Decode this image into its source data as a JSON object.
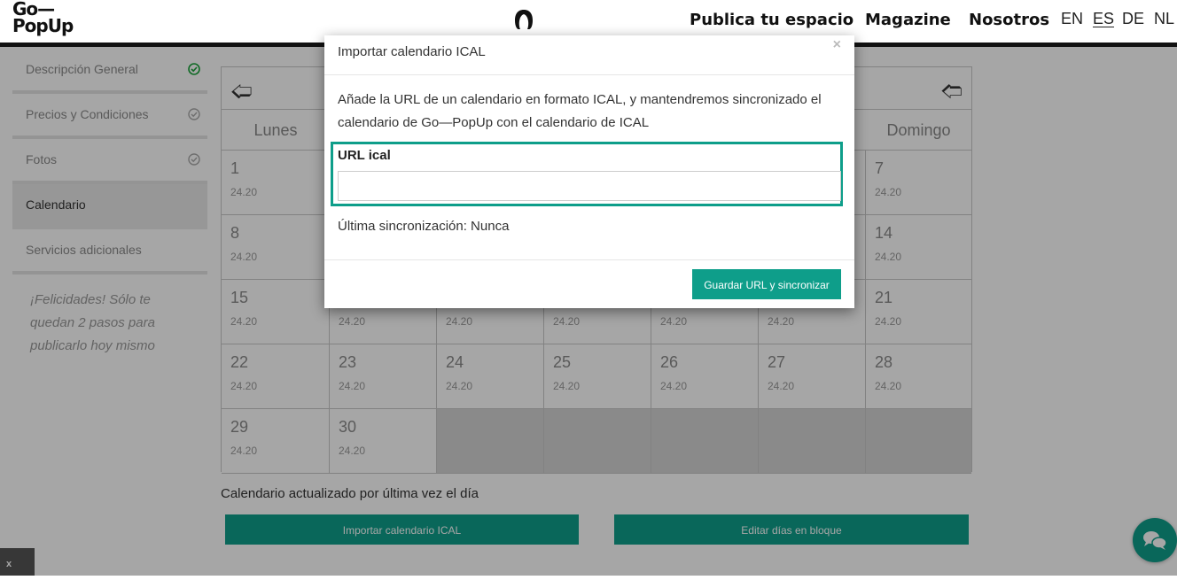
{
  "header": {
    "logo_line1": "Go—",
    "logo_line2": "PopUp",
    "nav": [
      "Publica tu espacio",
      "Magazine",
      "Nosotros"
    ],
    "languages": [
      "EN",
      "ES",
      "DE",
      "NL"
    ],
    "active_language": "ES"
  },
  "sidebar": {
    "items": [
      {
        "label": "Descripción General",
        "status": "complete"
      },
      {
        "label": "Precios y Condiciones",
        "status": "done"
      },
      {
        "label": "Fotos",
        "status": "done"
      },
      {
        "label": "Calendario",
        "status": "active"
      },
      {
        "label": "Servicios adicionales",
        "status": "none"
      }
    ],
    "message": "¡Felicidades! Sólo te quedan 2 pasos para publicarlo hoy mismo"
  },
  "calendar": {
    "prev_icon": "arrow-left-icon",
    "next_icon": "arrow-right-icon",
    "day_names": [
      "Lunes",
      "",
      "",
      "",
      "",
      "",
      "Domingo"
    ],
    "weeks": [
      [
        {
          "day": "1",
          "price": "24.20"
        },
        {
          "day": "",
          "price": ""
        },
        {
          "day": "",
          "price": ""
        },
        {
          "day": "",
          "price": ""
        },
        {
          "day": "",
          "price": ""
        },
        {
          "day": "",
          "price": ""
        },
        {
          "day": "7",
          "price": "24.20"
        }
      ],
      [
        {
          "day": "8",
          "price": "24.20"
        },
        {
          "day": "",
          "price": ""
        },
        {
          "day": "",
          "price": ""
        },
        {
          "day": "",
          "price": ""
        },
        {
          "day": "",
          "price": ""
        },
        {
          "day": "",
          "price": ""
        },
        {
          "day": "14",
          "price": "24.20"
        }
      ],
      [
        {
          "day": "15",
          "price": "24.20"
        },
        {
          "day": "",
          "price": "24.20"
        },
        {
          "day": "",
          "price": "24.20"
        },
        {
          "day": "",
          "price": "24.20"
        },
        {
          "day": "",
          "price": "24.20"
        },
        {
          "day": "",
          "price": "24.20"
        },
        {
          "day": "21",
          "price": "24.20"
        }
      ],
      [
        {
          "day": "22",
          "price": "24.20"
        },
        {
          "day": "23",
          "price": "24.20"
        },
        {
          "day": "24",
          "price": "24.20"
        },
        {
          "day": "25",
          "price": "24.20"
        },
        {
          "day": "26",
          "price": "24.20"
        },
        {
          "day": "27",
          "price": "24.20"
        },
        {
          "day": "28",
          "price": "24.20"
        }
      ],
      [
        {
          "day": "29",
          "price": "24.20"
        },
        {
          "day": "30",
          "price": "24.20"
        },
        null,
        null,
        null,
        null,
        null
      ]
    ],
    "note": "Calendario actualizado por última vez el día",
    "import_button": "Importar calendario ICAL",
    "bulk_button": "Editar días en bloque"
  },
  "bottom_close": "x",
  "modal": {
    "title": "Importar calendario ICAL",
    "close": "×",
    "description": "Añade la URL de un calendario en formato ICAL, y mantendremos sincronizado el calendario de Go—PopUp con el calendario de ICAL",
    "url_label": "URL ical",
    "url_value": "",
    "last_sync": "Última sincronización: Nunca",
    "save_button": "Guardar URL y sincronizar"
  },
  "colors": {
    "accent": "#0e9e8a",
    "header_bar": "#1c1c1c"
  }
}
